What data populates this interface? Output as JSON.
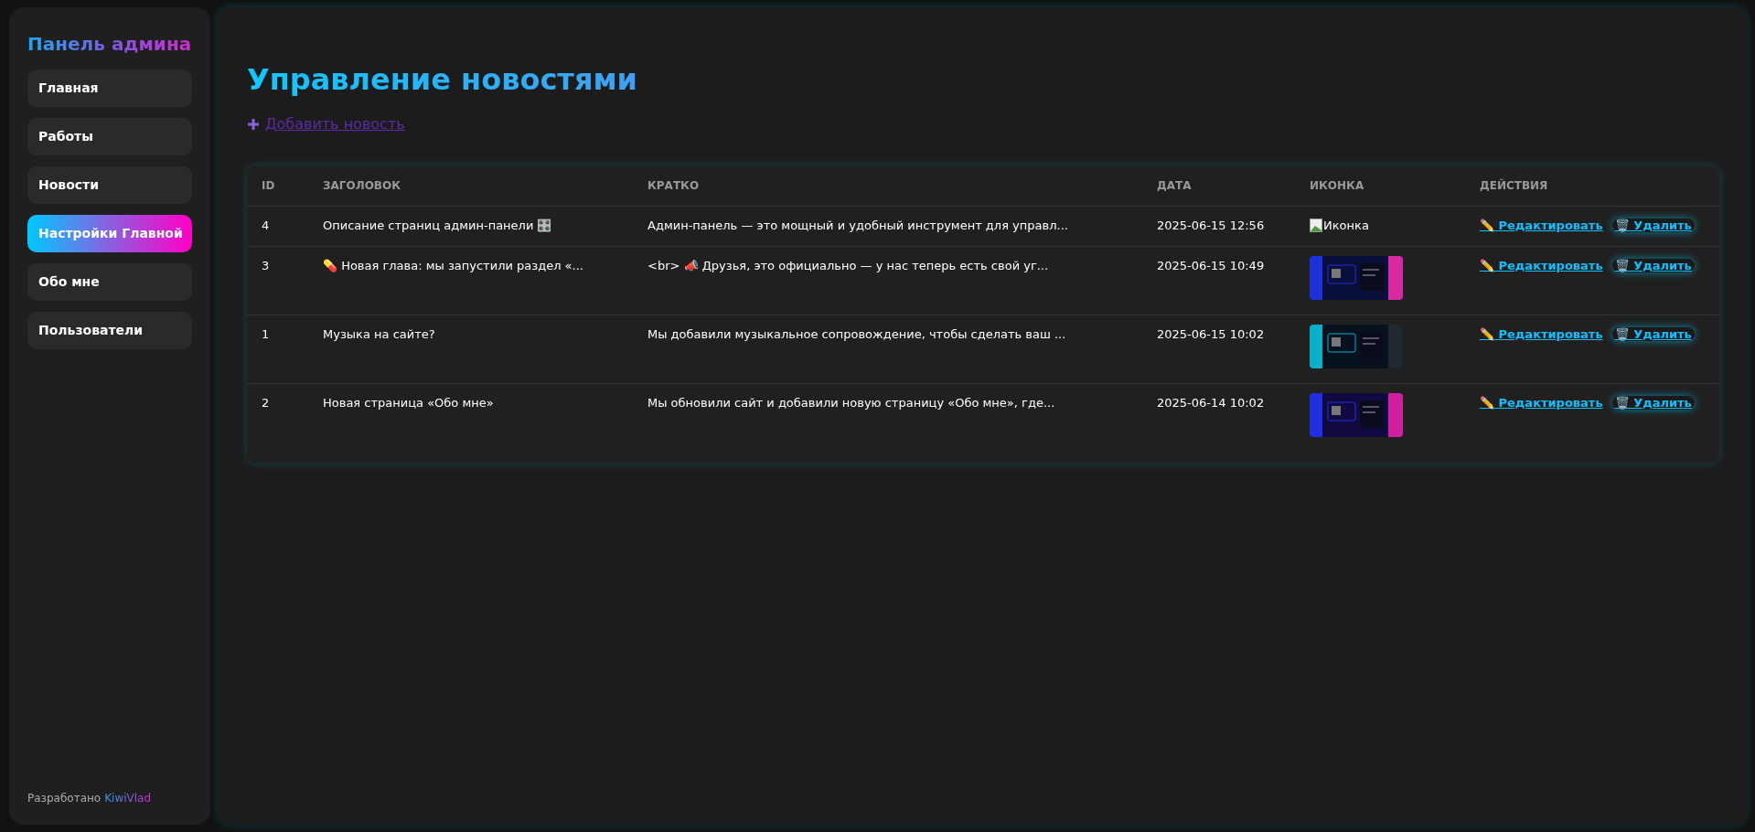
{
  "sidebar": {
    "title": "Панель админа",
    "items": [
      {
        "label": "Главная",
        "selected": false
      },
      {
        "label": "Работы",
        "selected": false
      },
      {
        "label": "Новости",
        "selected": false
      },
      {
        "label": "Настройки Главной",
        "selected": true
      },
      {
        "label": "Обо мне",
        "selected": false
      },
      {
        "label": "Пользователи",
        "selected": false
      }
    ],
    "footer": {
      "text": "Разработано",
      "link": "KiwiVlad"
    }
  },
  "page": {
    "title": "Управление новостями",
    "add_link": "Добавить новость"
  },
  "table": {
    "columns": [
      "ID",
      "ЗАГОЛОВОК",
      "КРАТКО",
      "ДАТА",
      "ИКОНКА",
      "ДЕЙСТВИЯ"
    ],
    "rows": [
      {
        "id": "4",
        "title": "Описание страниц админ-панели 🎛️",
        "brief": "Админ-панель — это мощный и удобный инструмент для управл...",
        "date": "2025-06-15 12:56",
        "icon": {
          "kind": "broken",
          "alt": "Иконка"
        },
        "edit": "✏️ Редактировать",
        "delete": "🗑️ Удалить"
      },
      {
        "id": "3",
        "title": "💊 Новая глава: мы запустили раздел «...",
        "brief": "<br> 📣 Друзья, это официально — у нас теперь есть свой уг...",
        "date": "2025-06-15 10:49",
        "edit": "✏️ Редактировать",
        "delete": "🗑️ Удалить"
      },
      {
        "id": "1",
        "title": "Музыка на сайте?",
        "brief": "Мы добавили музыкальное сопровождение, чтобы сделать ваш ...",
        "date": "2025-06-15 10:02",
        "edit": "✏️ Редактировать",
        "delete": "🗑️ Удалить"
      },
      {
        "id": "2",
        "title": "Новая страница «Обо мне»",
        "brief": "Мы обновили сайт и добавили новую страницу «Обо мне», где...",
        "date": "2025-06-14 10:02",
        "edit": "✏️ Редактировать",
        "delete": "🗑️ Удалить"
      }
    ]
  }
}
